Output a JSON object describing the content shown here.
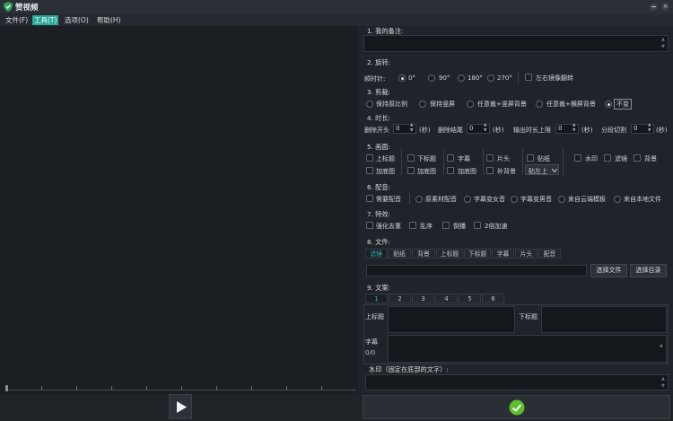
{
  "app": {
    "title": "赞视频"
  },
  "menu": [
    "文件(F)",
    "工具(T)",
    "选项(O)",
    "帮助(H)"
  ],
  "sections": {
    "remark": "1. 我的备注:",
    "rotate": "2. 旋转:",
    "crop": "3. 剪裁:",
    "duration": "4. 时长:",
    "frame": "5. 画面:",
    "dub": "6. 配音:",
    "effect": "7. 特效:",
    "files": "8. 文件:",
    "copy": "9. 文案:"
  },
  "rotate": {
    "label": "顺时针:",
    "options": [
      "0°",
      "90°",
      "180°",
      "270°"
    ],
    "selected": 0,
    "mirror": "左右镜像翻转"
  },
  "crop": {
    "options": [
      "保持原比例",
      "保持竖屏",
      "任意裁+竖屏背景",
      "任意裁+横屏背景",
      "不变"
    ],
    "selected": 4
  },
  "duration": {
    "head_label": "删除开头",
    "head_value": "0",
    "unit1": "(秒)",
    "tail_label": "删除结尾",
    "tail_value": "0",
    "unit2": "(秒)",
    "max_label": "输出时长上限",
    "max_value": "0",
    "unit3": "(秒)",
    "split_label": "分段切割",
    "split_value": "0",
    "unit4": "(秒)"
  },
  "frame": {
    "row1": [
      "上标题",
      "下标题",
      "字幕",
      "片头",
      "贴纸"
    ],
    "row2": [
      "加底图",
      "加底图",
      "加底图",
      "补背景"
    ],
    "dropdown": "贴左上",
    "right": [
      "水印",
      "滤镜",
      "背景"
    ]
  },
  "dub": {
    "options": [
      "需要配音",
      "原素材配音",
      "字幕变女音",
      "字幕变男音",
      "来自云端模板",
      "来自本地文件"
    ]
  },
  "effect": {
    "options": [
      "强化去重",
      "乱序",
      "倒播",
      "2倍加速"
    ]
  },
  "files": {
    "tabs": [
      "滤镜",
      "贴纸",
      "背景",
      "上标题",
      "下标题",
      "字幕",
      "片头",
      "配音"
    ],
    "active": 0,
    "choose_file": "选择文件",
    "choose_dir": "选择目录"
  },
  "copy": {
    "tabs": [
      "1",
      "2",
      "3",
      "4",
      "5",
      "6"
    ],
    "active": 0,
    "top_title": "上标题",
    "bottom_title": "下标题",
    "subtitle": "字幕",
    "count": "0/0",
    "watermark": "水印（固定在底部的文字）:"
  },
  "icons": {
    "app": "shield-logo-icon",
    "play": "play-icon",
    "confirm": "check-icon"
  },
  "colors": {
    "accent": "#2aa99a",
    "confirm": "#5cbf2a"
  }
}
